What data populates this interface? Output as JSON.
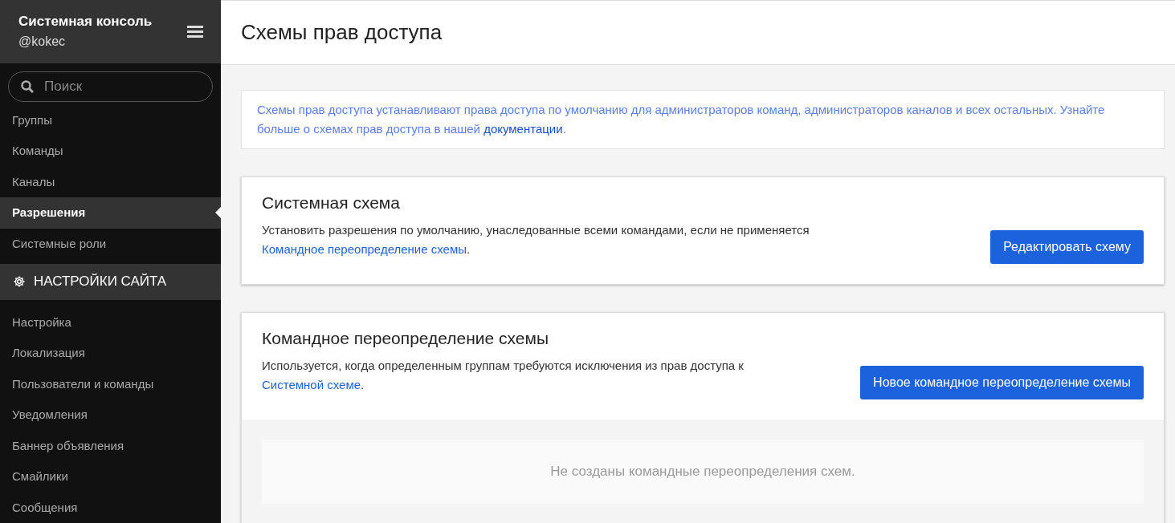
{
  "sidebar": {
    "title": "Системная консоль",
    "username": "@kokec",
    "search": {
      "placeholder": "Поиск"
    },
    "items": [
      {
        "label": "Группы",
        "selected": false
      },
      {
        "label": "Команды",
        "selected": false
      },
      {
        "label": "Каналы",
        "selected": false
      },
      {
        "label": "Разрешения",
        "selected": true
      },
      {
        "label": "Системные роли",
        "selected": false
      }
    ],
    "section": {
      "title": "НАСТРОЙКИ САЙТА",
      "items": [
        {
          "label": "Настройка",
          "selected": false
        },
        {
          "label": "Локализация",
          "selected": false
        },
        {
          "label": "Пользователи и команды",
          "selected": false
        },
        {
          "label": "Уведомления",
          "selected": false
        },
        {
          "label": "Баннер объявления",
          "selected": false
        },
        {
          "label": "Смайлики",
          "selected": false
        },
        {
          "label": "Сообщения",
          "selected": false
        }
      ]
    }
  },
  "page": {
    "title": "Схемы прав доступа",
    "banner": {
      "text_before": "Схемы прав доступа устанавливают права доступа по умолчанию для администраторов команд, администраторов каналов и всех остальных. Узнайте больше о схемах прав доступа в нашей ",
      "link": "документации",
      "text_after": "."
    },
    "cards": [
      {
        "title": "Системная схема",
        "text_before": "Установить разрешения по умолчанию, унаследованные всеми командами, если не применяется ",
        "link": "Командное переопределение схемы",
        "text_after": ".",
        "button": "Редактировать схему"
      },
      {
        "title": "Командное переопределение схемы",
        "text_before": "Используется, когда определенным группам требуются исключения из прав доступа к ",
        "link": "Системной схеме",
        "text_after": ".",
        "button": "Новое командное переопределение схемы",
        "empty": "Не созданы командные переопределения схем."
      }
    ]
  }
}
